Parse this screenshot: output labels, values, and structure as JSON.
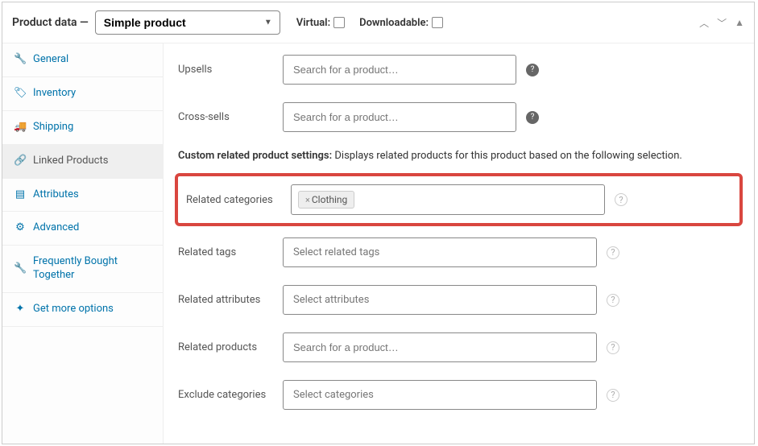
{
  "header": {
    "title": "Product data —",
    "type_select": "Simple product",
    "virtual_label": "Virtual:",
    "downloadable_label": "Downloadable:"
  },
  "sidebar": {
    "items": [
      {
        "label": "General"
      },
      {
        "label": "Inventory"
      },
      {
        "label": "Shipping"
      },
      {
        "label": "Linked Products"
      },
      {
        "label": "Attributes"
      },
      {
        "label": "Advanced"
      },
      {
        "label": "Frequently Bought Together"
      },
      {
        "label": "Get more options"
      }
    ]
  },
  "main": {
    "upsells_label": "Upsells",
    "upsells_placeholder": "Search for a product…",
    "crosssells_label": "Cross-sells",
    "crosssells_placeholder": "Search for a product…",
    "custom_header_bold": "Custom related product settings:",
    "custom_header_rest": " Displays related products for this product based on the following selection.",
    "related_categories_label": "Related categories",
    "related_categories_tag": "Clothing",
    "related_tags_label": "Related tags",
    "related_tags_placeholder": "Select related tags",
    "related_attributes_label": "Related attributes",
    "related_attributes_placeholder": "Select attributes",
    "related_products_label": "Related products",
    "related_products_placeholder": "Search for a product…",
    "exclude_categories_label": "Exclude categories",
    "exclude_categories_placeholder": "Select categories"
  }
}
